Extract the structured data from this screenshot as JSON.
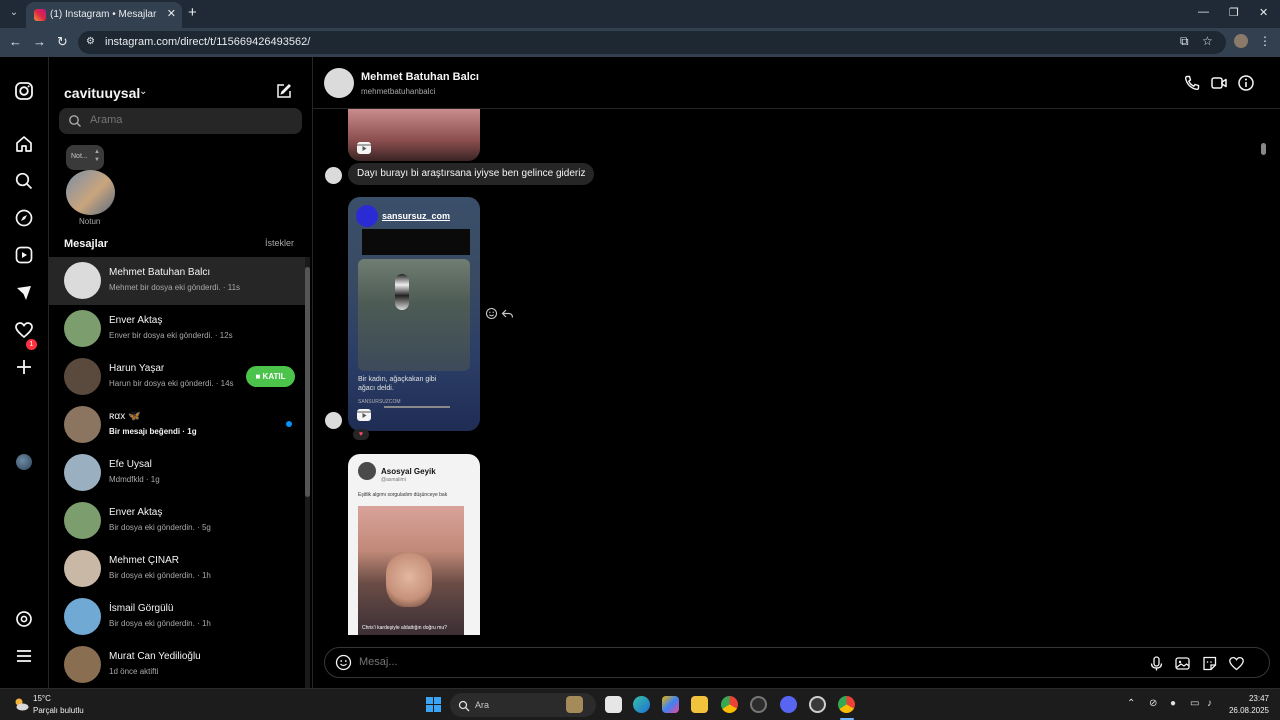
{
  "browser": {
    "tab_title": "(1) Instagram • Mesajlar",
    "url": "instagram.com/direct/t/115669426493562/"
  },
  "inbox": {
    "username": "cavituuysal",
    "search_placeholder": "Arama",
    "note_bubble": "Not...",
    "note_label": "Notun",
    "messages_title": "Mesajlar",
    "requests_label": "İstekler",
    "conversations": [
      {
        "name": "Mehmet Batuhan Balcı",
        "preview": "Mehmet bir dosya eki gönderdi. · 11s",
        "avatar_color": "#dbdbdb",
        "active": true
      },
      {
        "name": "Enver Aktaş",
        "preview": "Enver bir dosya eki gönderdi. · 12s",
        "avatar_color": "#7c9d6e"
      },
      {
        "name": "Harun Yaşar",
        "preview": "Harun bir dosya eki gönderdi. · 14s",
        "avatar_color": "#5a4a3e",
        "join_label": "KATIL"
      },
      {
        "name": "ʀαx 🦋",
        "preview": "Bir mesajı beğendi · 1g",
        "avatar_color": "#8b7560",
        "unread": true
      },
      {
        "name": "Efe Uysal",
        "preview": "Mdmdfkld · 1g",
        "avatar_color": "#9ab0c0"
      },
      {
        "name": "Enver Aktaş",
        "preview": "Bir dosya eki gönderdin. · 5g",
        "avatar_color": "#7c9d6e"
      },
      {
        "name": "Mehmet ÇINAR",
        "preview": "Bir dosya eki gönderdin. · 1h",
        "avatar_color": "#c9b8a5"
      },
      {
        "name": "İsmail Görgülü",
        "preview": "Bir dosya eki gönderdin. · 1h",
        "avatar_color": "#6fa9d4"
      },
      {
        "name": "Murat Can Yedilioğlu",
        "preview": "1d önce aktifti",
        "avatar_color": "#8a6e52"
      }
    ]
  },
  "chat": {
    "name": "Mehmet Batuhan Balcı",
    "handle": "mehmetbatuhanbalci",
    "text_message": "Dayı burayı bi araştırsana iyiyse ben gelince gideriz",
    "reel1": {
      "account": "sansursuz_com",
      "caption_line1": "Bir kadın, ağaçkakan gibi",
      "caption_line2": "ağacı deldi.",
      "sub": "SANSURSUZCOM",
      "reaction": "♥"
    },
    "reel2": {
      "name": "Asosyal Geyik",
      "handle": "@asmalimi",
      "text": "Eşitlik algımı sorguladım düşünceye bak",
      "caption": "Chris'i kardeşiyle aldattığın doğru mu?"
    },
    "composer_placeholder": "Mesaj..."
  },
  "taskbar": {
    "temperature": "15°C",
    "weather": "Parçalı bulutlu",
    "search_label": "Ara",
    "time": "23:47",
    "date": "26.08.2025"
  }
}
